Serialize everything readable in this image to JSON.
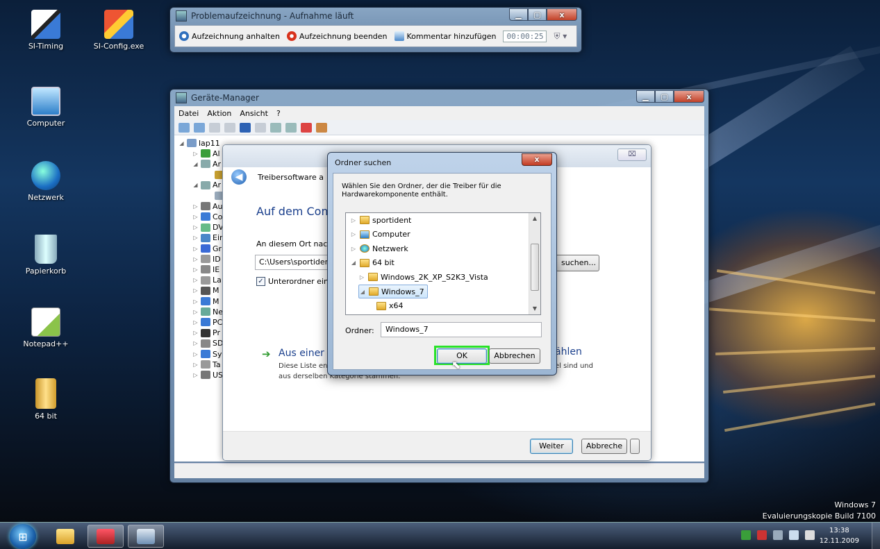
{
  "desktop_icons": [
    {
      "label": "SI-Timing",
      "icon": "si-timing-icon"
    },
    {
      "label": "SI-Config.exe",
      "icon": "si-config-icon"
    },
    {
      "label": "Computer",
      "icon": "computer-icon"
    },
    {
      "label": "Netzwerk",
      "icon": "network-icon"
    },
    {
      "label": "Papierkorb",
      "icon": "recycle-bin-icon"
    },
    {
      "label": "Notepad++",
      "icon": "notepad-icon"
    },
    {
      "label": "64 bit",
      "icon": "folder-icon"
    }
  ],
  "recorder": {
    "title": "Problemaufzeichnung - Aufnahme läuft",
    "pause_label": "Aufzeichnung anhalten",
    "stop_label": "Aufzeichnung beenden",
    "comment_label": "Kommentar hinzufügen",
    "timer": "00:00:25"
  },
  "device_manager": {
    "title": "Geräte-Manager",
    "menu": [
      "Datei",
      "Aktion",
      "Ansicht",
      "?"
    ],
    "tree": [
      {
        "label": "lap11",
        "exp": "◢"
      },
      {
        "label": "Al",
        "exp": "▷"
      },
      {
        "label": "Ar",
        "exp": "◢"
      },
      {
        "label": "",
        "exp": ""
      },
      {
        "label": "Ar",
        "exp": "◢"
      },
      {
        "label": "",
        "exp": ""
      },
      {
        "label": "Au",
        "exp": "▷"
      },
      {
        "label": "Co",
        "exp": "▷"
      },
      {
        "label": "DV",
        "exp": "▷"
      },
      {
        "label": "Eir",
        "exp": "▷"
      },
      {
        "label": "Gr",
        "exp": "▷"
      },
      {
        "label": "ID",
        "exp": "▷"
      },
      {
        "label": "IE",
        "exp": "▷"
      },
      {
        "label": "La",
        "exp": "▷"
      },
      {
        "label": "M",
        "exp": "▷"
      },
      {
        "label": "M",
        "exp": "▷"
      },
      {
        "label": "Ne",
        "exp": "▷"
      },
      {
        "label": "PC",
        "exp": "▷"
      },
      {
        "label": "Pr",
        "exp": "▷"
      },
      {
        "label": "SD",
        "exp": "▷"
      },
      {
        "label": "Sy",
        "exp": "▷"
      },
      {
        "label": "Ta",
        "exp": "▷"
      },
      {
        "label": "US",
        "exp": "▷"
      }
    ]
  },
  "wizard": {
    "close_label": "⌧",
    "header_title": "Treibersoftware a",
    "heading": "Auf dem Comp",
    "location_label": "An diesem Ort nach",
    "path_value": "C:\\Users\\sportident",
    "browse_label": "suchen...",
    "subfolders_label": "Unterordner einb",
    "subfolders_checked": true,
    "link_start": "Aus einer L",
    "link_end": "ählen",
    "desc_line1": "Diese Liste ent",
    "desc_line1_end": "el sind und",
    "desc_line2": "aus derselben Kategorie stammen.",
    "next_label": "Weiter",
    "cancel_label": "Abbreche"
  },
  "browse_dialog": {
    "title": "Ordner suchen",
    "close_label": "x",
    "description": "Wählen Sie den Ordner, der die Treiber für die Hardwarekomponente enthält.",
    "tree": [
      {
        "label": "sportident",
        "exp": "▷",
        "depth": 0,
        "icon": "user-folder-icon"
      },
      {
        "label": "Computer",
        "exp": "▷",
        "depth": 0,
        "icon": "computer-icon"
      },
      {
        "label": "Netzwerk",
        "exp": "▷",
        "depth": 0,
        "icon": "network-icon"
      },
      {
        "label": "64 bit",
        "exp": "◢",
        "depth": 0,
        "icon": "folder-icon"
      },
      {
        "label": "Windows_2K_XP_S2K3_Vista",
        "exp": "▷",
        "depth": 1,
        "icon": "folder-icon"
      },
      {
        "label": "Windows_7",
        "exp": "◢",
        "depth": 1,
        "icon": "folder-icon",
        "selected": true
      },
      {
        "label": "x64",
        "exp": "",
        "depth": 2,
        "icon": "folder-icon"
      }
    ],
    "folder_label": "Ordner:",
    "folder_value": "Windows_7",
    "ok_label": "OK",
    "cancel_label": "Abbrechen"
  },
  "watermark": {
    "line1": "Windows 7",
    "line2": "Evaluierungskopie Build 7100"
  },
  "taskbar": {
    "time": "13:38",
    "date": "12.11.2009"
  }
}
